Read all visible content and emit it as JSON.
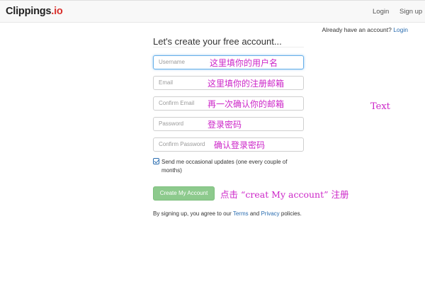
{
  "navbar": {
    "brand_main": "Clippings",
    "brand_tld": ".io",
    "login_label": "Login",
    "signup_label": "Sign up"
  },
  "account_prompt": {
    "text": "Already have an account?",
    "link_label": "Login"
  },
  "form": {
    "title": "Let's create your free account...",
    "fields": [
      {
        "placeholder": "Username",
        "annotation": "这里填你的用户名"
      },
      {
        "placeholder": "Email",
        "annotation": "这里填你的注册邮箱"
      },
      {
        "placeholder": "Confirm Email",
        "annotation": "再一次确认你的邮箱"
      },
      {
        "placeholder": "Password",
        "annotation": "登录密码"
      },
      {
        "placeholder": "Confirm Password",
        "annotation": "确认登录密码"
      }
    ],
    "updates_checked": true,
    "updates_label": "Send me occasional updates (one every couple of months)",
    "submit_label": "Create My Account",
    "submit_annotation": "点击 “creat My account” 注册",
    "terms_prefix": "By signing up, you agree to our",
    "terms_link": "Terms",
    "terms_and": "and",
    "privacy_link": "Privacy",
    "terms_suffix": "policies."
  },
  "side_annotation": "Text",
  "colors": {
    "annotation": "#cc26c8",
    "link": "#2a6db0",
    "button": "#8dca8d",
    "brand_tld": "#d9302c"
  }
}
